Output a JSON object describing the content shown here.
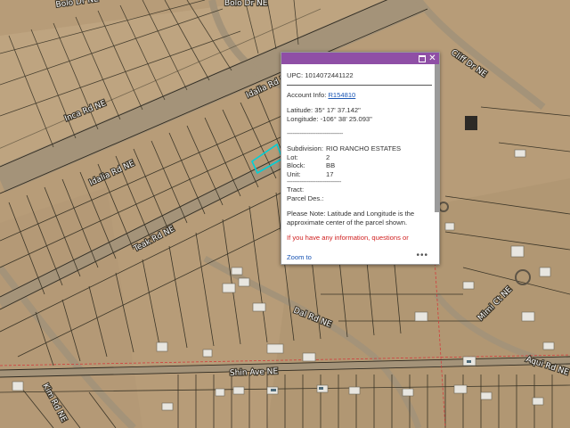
{
  "map": {
    "roads": [
      {
        "name": "Bolo Dr NE"
      },
      {
        "name": "Bolo Dr NE"
      },
      {
        "name": "Cliff Dr NE"
      },
      {
        "name": "Inca Rd NE"
      },
      {
        "name": "Idalia Rd NE"
      },
      {
        "name": "Idalia Rd NE"
      },
      {
        "name": "Teak Rd NE"
      },
      {
        "name": "Dal Rd NE"
      },
      {
        "name": "Mimi Ct NE"
      },
      {
        "name": "Aqui Rd NE"
      },
      {
        "name": "Shin Ave NE"
      },
      {
        "name": "Kim Rd NE"
      }
    ],
    "colors": {
      "land": "#b79c78",
      "parcel_line": "#3b3527",
      "road": "#9a8a72",
      "selection": "#00d0d8",
      "boundary": "#d23c3c"
    }
  },
  "popup": {
    "upc": "UPC: 1014072441122",
    "account_label": "Account Info: ",
    "account_link": "R154810",
    "latitude": "Latitude: 35° 17' 37.142\"",
    "longitude": "Longitude: -106° 38' 25.093\"",
    "divider1": "-------------------------------",
    "subdivision_label": "Subdivision:",
    "subdivision_value": "RIO RANCHO ESTATES",
    "lot_label": "Lot:",
    "lot_value": "2",
    "block_label": "Block:",
    "block_value": "BB",
    "unit_label": "Unit:",
    "unit_value": "17",
    "divider2": "------------------------------",
    "tract_label": "Tract:",
    "parcel_label": "Parcel Des.:",
    "note": "Please Note: Latitude and Longitude is the approximate center of the parcel shown.",
    "red_note": "If you have any information, questions or",
    "zoom_label": "Zoom to",
    "more_label": "•••",
    "maximize_icon": "maximize-icon",
    "close_icon": "close-icon",
    "close_glyph": "✕"
  }
}
